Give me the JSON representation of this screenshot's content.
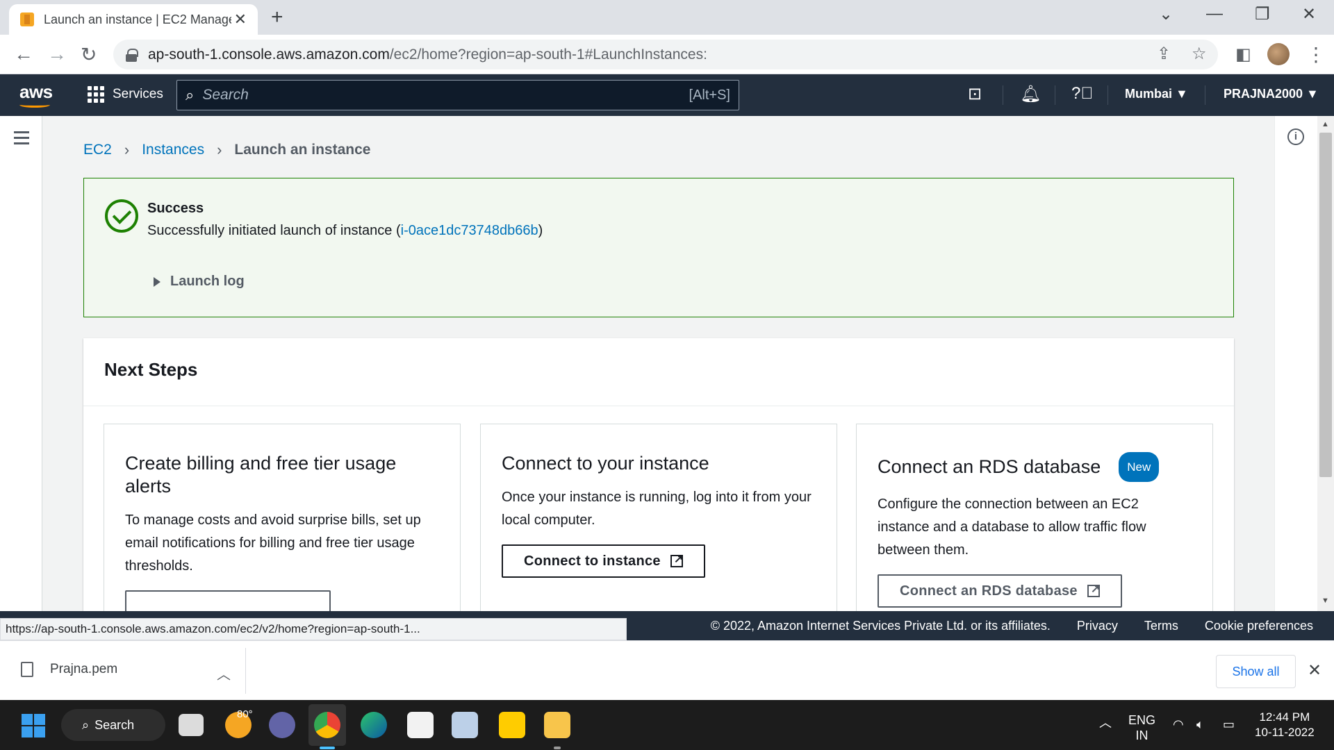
{
  "browser": {
    "tab_title": "Launch an instance | EC2 Manage",
    "url_host": "ap-south-1.console.aws.amazon.com",
    "url_path": "/ec2/home?region=ap-south-1#LaunchInstances:"
  },
  "aws_nav": {
    "logo": "aws",
    "services_label": "Services",
    "search_placeholder": "Search",
    "search_shortcut": "[Alt+S]",
    "region": "Mumbai ▼",
    "account": "PRAJNA2000 ▼"
  },
  "breadcrumb": {
    "items": [
      "EC2",
      "Instances"
    ],
    "current": "Launch an instance"
  },
  "flash": {
    "title": "Success",
    "message_prefix": "Successfully initiated launch of instance (",
    "instance_id": "i-0ace1dc73748db66b",
    "message_suffix": ")",
    "launch_log": "Launch log"
  },
  "next_steps": {
    "title": "Next Steps",
    "cards": [
      {
        "title": "Create billing and free tier usage alerts",
        "body": "To manage costs and avoid surprise bills, set up email notifications for billing and free tier usage thresholds.",
        "button": ""
      },
      {
        "title": "Connect to your instance",
        "body": "Once your instance is running, log into it from your local computer.",
        "button": "Connect to instance"
      },
      {
        "title": "Connect an RDS database",
        "badge": "New",
        "body": "Configure the connection between an EC2 instance and a database to allow traffic flow between them.",
        "button": "Connect an RDS database"
      }
    ]
  },
  "status_url": "https://ap-south-1.console.aws.amazon.com/ec2/v2/home?region=ap-south-1...",
  "footer": {
    "copyright": "© 2022, Amazon Internet Services Private Ltd. or its affiliates.",
    "links": [
      "Privacy",
      "Terms",
      "Cookie preferences"
    ]
  },
  "downloads": {
    "file": "Prajna.pem",
    "show_all": "Show all"
  },
  "taskbar": {
    "search": "Search",
    "weather_temp": "80°",
    "lang_1": "ENG",
    "lang_2": "IN",
    "time": "12:44 PM",
    "date": "10-11-2022"
  },
  "colors": {
    "aws_nav_bg": "#232f3e",
    "aws_orange": "#ff9900",
    "link_blue": "#0073bb",
    "success_green": "#1d8102"
  }
}
